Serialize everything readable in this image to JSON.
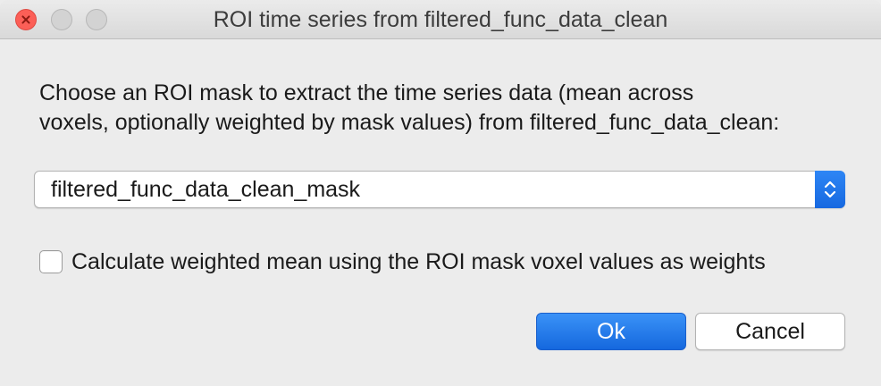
{
  "window": {
    "title": "ROI time series from filtered_func_data_clean"
  },
  "prompt": {
    "line1": "Choose an ROI mask to extract the time series data (mean across",
    "line2": "voxels, optionally weighted by mask values) from filtered_func_data_clean:"
  },
  "roi_select": {
    "selected_value": "filtered_func_data_clean_mask",
    "arrow_icon": "up-down-chevron-icon"
  },
  "weighted_mean": {
    "label": "Calculate weighted mean using the ROI mask voxel values as weights",
    "checked": false
  },
  "buttons": {
    "ok_label": "Ok",
    "cancel_label": "Cancel"
  },
  "colors": {
    "accent": "#1f74ea",
    "close_button": "#fc5f57",
    "background": "#ececec"
  }
}
